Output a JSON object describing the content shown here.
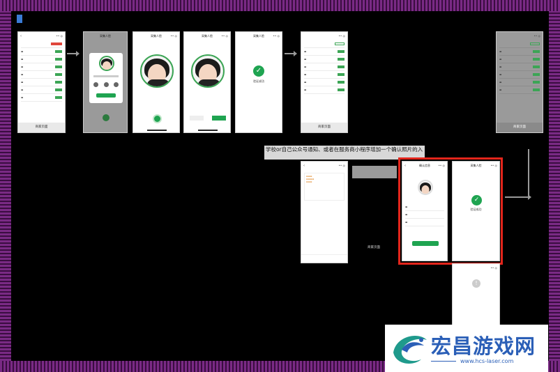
{
  "tag": "",
  "screens": {
    "list_title": "",
    "list_bottom": "商家页面",
    "face_title": "采集人脸",
    "success_title": "",
    "success_text": "验证成功",
    "success_text2": "验证成功",
    "confirm_title": "确认信息",
    "confirm_btn": "",
    "merchant_label": "商家页面",
    "error_title": "",
    "error_text": ""
  },
  "caption": {
    "line1": "",
    "line2": "学校or自己公众号通知、或者在服务商小程序增加一个确认照片的入"
  },
  "watermark": {
    "title": "宏昌游戏网",
    "url": "www.hcs-laser.com"
  },
  "colors": {
    "accent": "#1fa451",
    "frame": "#7a2a85",
    "highlight": "#e3251b",
    "brand": "#2b5fb7"
  }
}
